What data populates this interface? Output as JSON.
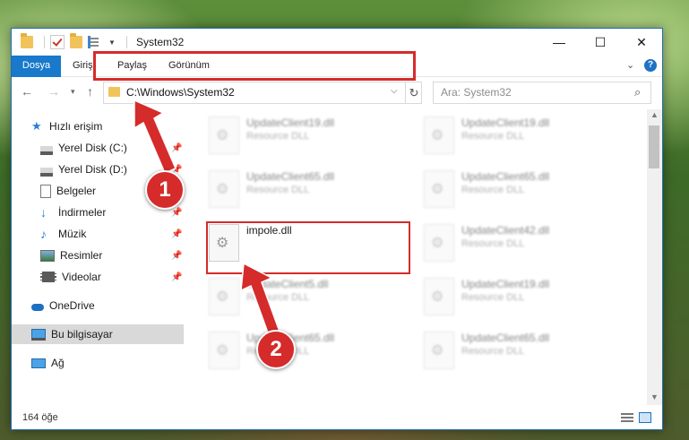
{
  "window": {
    "title": "System32"
  },
  "ribbon": {
    "tabs": [
      "Dosya",
      "Giriş",
      "Paylaş",
      "Görünüm"
    ]
  },
  "address": {
    "path": "C:\\Windows\\System32",
    "search_placeholder": "Ara: System32"
  },
  "nav_pane": {
    "quick_access": "Hızlı erişim",
    "items": [
      {
        "label": "Yerel Disk (C:)",
        "icon": "drive-icon",
        "pinned": true
      },
      {
        "label": "Yerel Disk (D:)",
        "icon": "drive-icon",
        "pinned": true
      },
      {
        "label": "Belgeler",
        "icon": "documents-icon",
        "pinned": true
      },
      {
        "label": "İndirmeler",
        "icon": "downloads-icon",
        "pinned": true
      },
      {
        "label": "Müzik",
        "icon": "music-icon",
        "pinned": true
      },
      {
        "label": "Resimler",
        "icon": "pictures-icon",
        "pinned": true
      },
      {
        "label": "Videolar",
        "icon": "videos-icon",
        "pinned": true
      }
    ],
    "onedrive": "OneDrive",
    "this_pc": "Bu bilgisayar",
    "network": "Ağ"
  },
  "files": {
    "col1": [
      {
        "name": "UpdateClient19.dll",
        "type": "Resource DLL"
      },
      {
        "name": "UpdateClient65.dll",
        "type": "Resource DLL"
      },
      {
        "name": "impole.dll",
        "type": ""
      },
      {
        "name": "UpdateClient5.dll",
        "type": "Resource DLL"
      },
      {
        "name": "UpdateClient65.dll",
        "type": "Resource DLL"
      }
    ],
    "col2": [
      {
        "name": "UpdateClient19.dll",
        "type": "Resource DLL"
      },
      {
        "name": "UpdateClient65.dll",
        "type": "Resource DLL"
      },
      {
        "name": "UpdateClient42.dll",
        "type": "Resource DLL"
      },
      {
        "name": "UpdateClient19.dll",
        "type": "Resource DLL"
      },
      {
        "name": "UpdateClient65.dll",
        "type": "Resource DLL"
      }
    ]
  },
  "status": {
    "count": "164 öğe"
  },
  "callouts": {
    "one": "1",
    "two": "2"
  },
  "colors": {
    "accent": "#1979ca",
    "highlight": "#d52b2b"
  }
}
